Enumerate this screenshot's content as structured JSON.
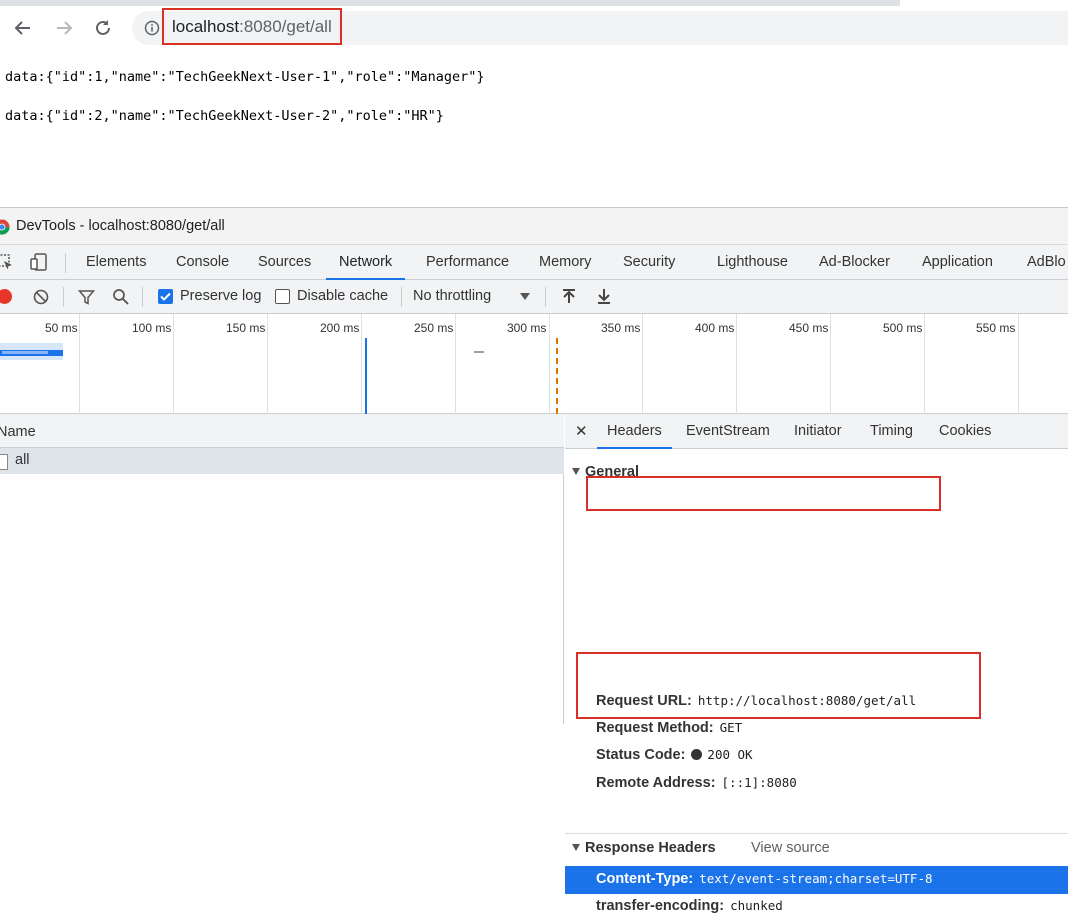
{
  "browser": {
    "url_host": "localhost",
    "url_path": ":8080/get/all"
  },
  "page": {
    "lines": [
      "data:{\"id\":1,\"name\":\"TechGeekNext-User-1\",\"role\":\"Manager\"}",
      "data:{\"id\":2,\"name\":\"TechGeekNext-User-2\",\"role\":\"HR\"}"
    ]
  },
  "devtools": {
    "window_title": "DevTools - localhost:8080/get/all",
    "tabs": [
      "Elements",
      "Console",
      "Sources",
      "Network",
      "Performance",
      "Memory",
      "Security",
      "Lighthouse",
      "Ad-Blocker",
      "Application",
      "AdBlo"
    ],
    "active_tab": "Network",
    "toolbar": {
      "preserve_log_label": "Preserve log",
      "preserve_log_checked": true,
      "disable_cache_label": "Disable cache",
      "disable_cache_checked": false,
      "throttling_value": "No throttling"
    },
    "timeline_ticks": [
      "50 ms",
      "100 ms",
      "150 ms",
      "200 ms",
      "250 ms",
      "300 ms",
      "350 ms",
      "400 ms",
      "450 ms",
      "500 ms",
      "550 ms"
    ],
    "requests": {
      "column_header": "Name",
      "rows": [
        "all"
      ]
    },
    "detail": {
      "tabs": [
        "Headers",
        "EventStream",
        "Initiator",
        "Timing",
        "Cookies"
      ],
      "active_tab": "Headers",
      "general": {
        "title": "General",
        "request_url_label": "Request URL:",
        "request_url_value": "http://localhost:8080/get/all",
        "request_method_label": "Request Method:",
        "request_method_value": "GET",
        "status_code_label": "Status Code:",
        "status_code_value": "200 OK",
        "remote_address_label": "Remote Address:",
        "remote_address_value": "[::1]:8080"
      },
      "response_headers": {
        "title": "Response Headers",
        "view_source": "View source",
        "content_type_label": "Content-Type:",
        "content_type_value": "text/event-stream;charset=UTF-8",
        "transfer_encoding_label": "transfer-encoding:",
        "transfer_encoding_value": "chunked"
      }
    }
  },
  "colors": {
    "accent_blue": "#1a73e8",
    "annotation_red": "#d93025",
    "record_red": "#e8352a"
  }
}
